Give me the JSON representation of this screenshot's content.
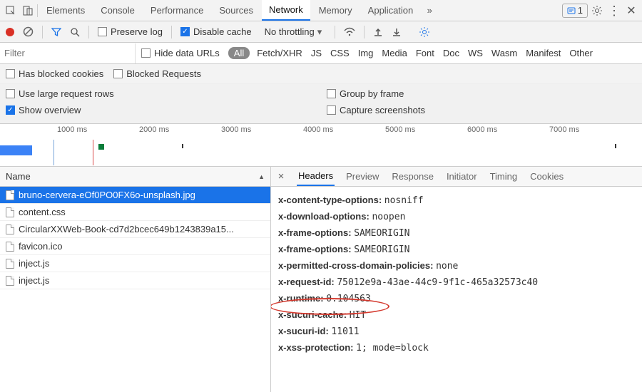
{
  "tabs": {
    "items": [
      "Elements",
      "Console",
      "Performance",
      "Sources",
      "Network",
      "Memory",
      "Application"
    ],
    "active": "Network",
    "badge_count": "1"
  },
  "toolbar": {
    "preserve_log": "Preserve log",
    "disable_cache": "Disable cache",
    "throttling": "No throttling"
  },
  "filter": {
    "placeholder": "Filter",
    "hide_data": "Hide data URLs",
    "types": [
      "All",
      "Fetch/XHR",
      "JS",
      "CSS",
      "Img",
      "Media",
      "Font",
      "Doc",
      "WS",
      "Wasm",
      "Manifest",
      "Other"
    ]
  },
  "opts": {
    "blocked_cookies": "Has blocked cookies",
    "blocked_requests": "Blocked Requests",
    "large_rows": "Use large request rows",
    "group_frame": "Group by frame",
    "show_overview": "Show overview",
    "capture": "Capture screenshots"
  },
  "timeline": {
    "ticks": [
      "1000 ms",
      "2000 ms",
      "3000 ms",
      "4000 ms",
      "5000 ms",
      "6000 ms",
      "7000 ms"
    ]
  },
  "left": {
    "header": "Name",
    "rows": [
      "bruno-cervera-eOf0PO0FX6o-unsplash.jpg",
      "content.css",
      "CircularXXWeb-Book-cd7d2bcec649b1243839a15...",
      "favicon.ico",
      "inject.js",
      "inject.js"
    ],
    "selected": 0
  },
  "right": {
    "tabs": [
      "Headers",
      "Preview",
      "Response",
      "Initiator",
      "Timing",
      "Cookies"
    ],
    "active": "Headers",
    "headers": [
      {
        "k": "x-content-type-options:",
        "v": "nosniff"
      },
      {
        "k": "x-download-options:",
        "v": "noopen"
      },
      {
        "k": "x-frame-options:",
        "v": "SAMEORIGIN"
      },
      {
        "k": "x-frame-options:",
        "v": "SAMEORIGIN"
      },
      {
        "k": "x-permitted-cross-domain-policies:",
        "v": "none"
      },
      {
        "k": "x-request-id:",
        "v": "75012e9a-43ae-44c9-9f1c-465a32573c40"
      },
      {
        "k": "x-runtime:",
        "v": "0.104563"
      },
      {
        "k": "x-sucuri-cache:",
        "v": "HIT"
      },
      {
        "k": "x-sucuri-id:",
        "v": "11011"
      },
      {
        "k": "x-xss-protection:",
        "v": "1; mode=block"
      }
    ]
  }
}
